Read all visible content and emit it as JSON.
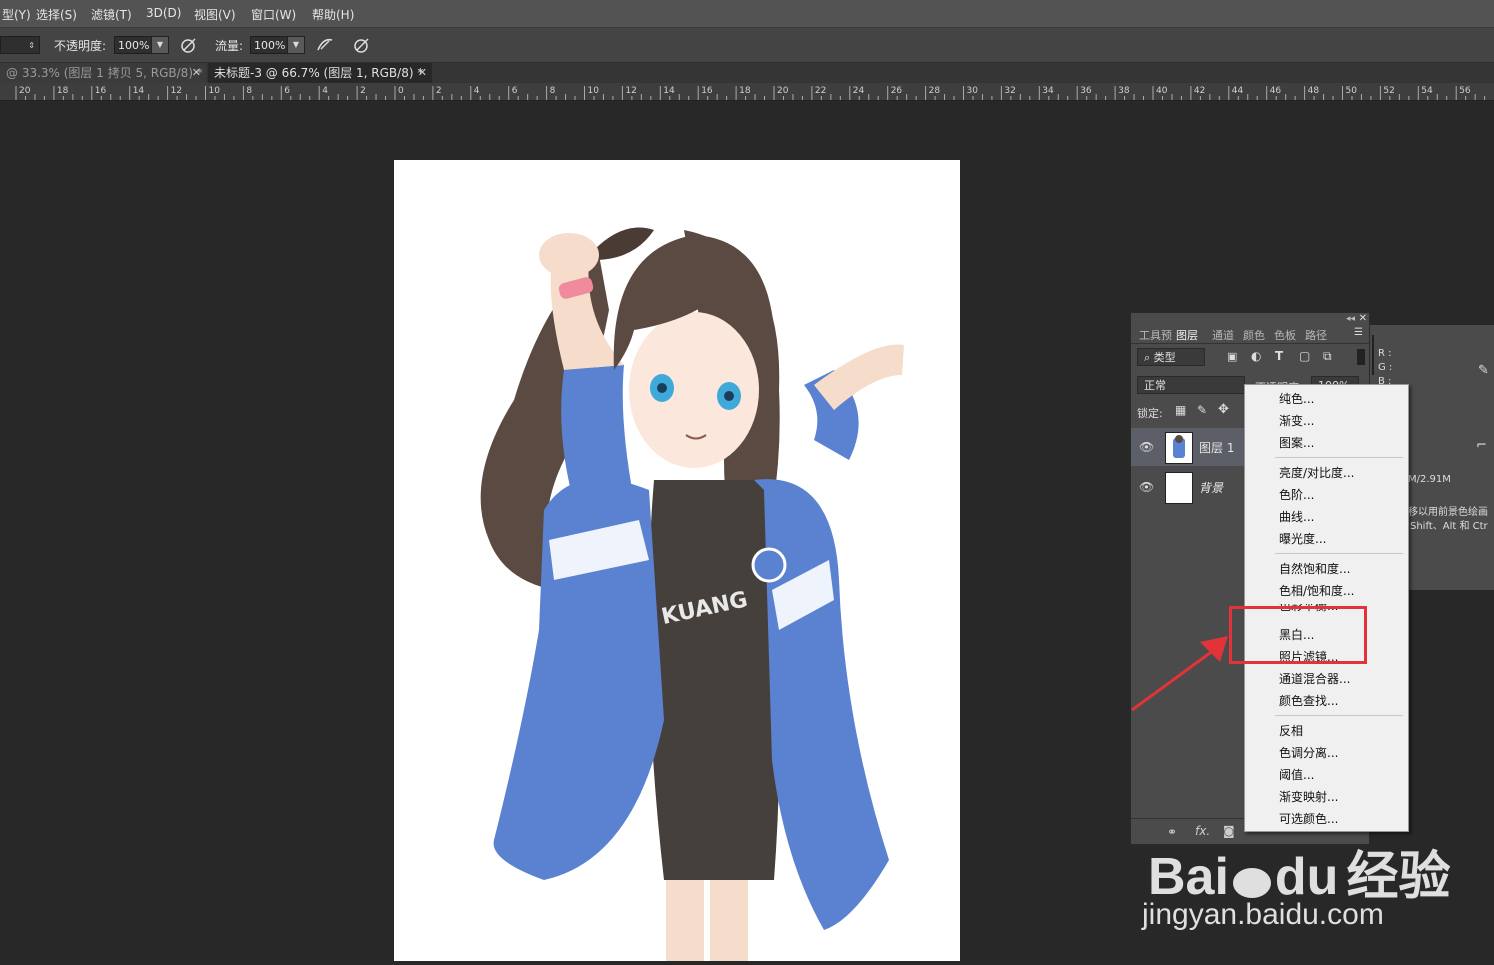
{
  "menubar": {
    "items": [
      "型(Y)",
      "选择(S)",
      "滤镜(T)",
      "3D(D)",
      "视图(V)",
      "窗口(W)",
      "帮助(H)"
    ]
  },
  "options": {
    "opacity_label": "不透明度:",
    "opacity_value": "100%",
    "flow_label": "流量:",
    "flow_value": "100%"
  },
  "tabs": [
    {
      "label": "@ 33.3% (图层 1 拷贝 5, RGB/8) *",
      "active": false
    },
    {
      "label": "未标题-3 @ 66.7% (图层 1, RGB/8) *",
      "active": true
    }
  ],
  "ruler": {
    "ticks": [
      "20",
      "18",
      "16",
      "14",
      "12",
      "10",
      "8",
      "6",
      "4",
      "2",
      "0",
      "2",
      "4",
      "6",
      "8",
      "10",
      "12",
      "14",
      "16",
      "18",
      "20",
      "22",
      "24",
      "26",
      "28",
      "30",
      "32",
      "34",
      "36",
      "38",
      "40",
      "42",
      "44",
      "46",
      "48",
      "50",
      "52",
      "54",
      "56"
    ]
  },
  "layers_panel": {
    "tabs": [
      "工具预",
      "图层",
      "通道",
      "颜色",
      "色板",
      "路径"
    ],
    "active_tab": "图层",
    "filter_kind": "类型",
    "blend_mode": "正常",
    "opacity_label": "不透明度:",
    "opacity_value": "100%",
    "lock_label": "锁定:",
    "layers": [
      {
        "name": "图层 1",
        "selected": true
      },
      {
        "name": "背景",
        "selected": false
      }
    ],
    "footer_icons": [
      "link-icon",
      "fx-icon",
      "mask-icon",
      "adjustment-icon",
      "folder-icon",
      "new-layer-icon",
      "trash-icon"
    ]
  },
  "info_panel": {
    "r_label": "R :",
    "g_label": "G :",
    "b_label": "B :",
    "doc_size": "M/2.91M",
    "hint_line1": "移以用前景色绘画",
    "hint_line2": "Shift、Alt 和 Ctr"
  },
  "context_menu": {
    "groups": [
      [
        "纯色...",
        "渐变...",
        "图案..."
      ],
      [
        "亮度/对比度...",
        "色阶...",
        "曲线...",
        "曝光度..."
      ],
      [
        "自然饱和度...",
        "色相/饱和度...",
        "色彩平衡...",
        "黑白...",
        "照片滤镜...",
        "通道混合器...",
        "颜色查找..."
      ],
      [
        "反相",
        "色调分离...",
        "阈值...",
        "渐变映射...",
        "可选颜色..."
      ]
    ],
    "highlighted": [
      "黑白...",
      "照片滤镜..."
    ]
  },
  "watermark": {
    "brand": "Bai",
    "brand2": "du",
    "brand_cn": "经验",
    "url": "jingyan.baidu.com"
  },
  "colors": {
    "highlight_box": "#e2323a",
    "arrow": "#e2323a",
    "jacket": "#5b82d1",
    "hair": "#5a4a42"
  }
}
